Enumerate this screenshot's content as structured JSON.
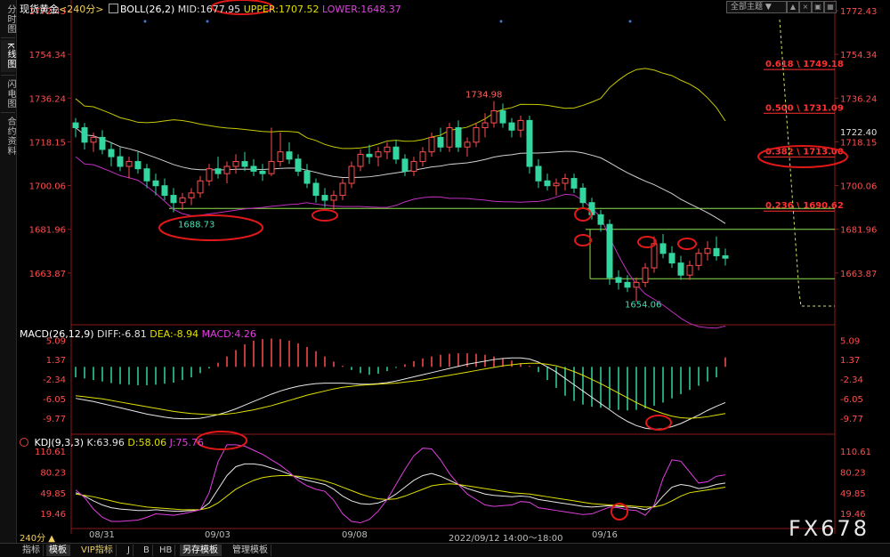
{
  "sidebar": {
    "tabs": [
      {
        "label": "分时图",
        "active": false
      },
      {
        "label": "K线图",
        "active": true
      },
      {
        "label": "闪电图",
        "active": false
      },
      {
        "label": "合约资料",
        "active": false
      }
    ]
  },
  "header": {
    "symbol": "现货黄金",
    "period": "<240分>",
    "boll_name": "BOLL(26,2)",
    "mid": "MID:1677.95",
    "upper": "UPPER:1707.52",
    "lower": "LOWER:1648.37",
    "theme_button": "全部主题",
    "theme_arrow": "▼"
  },
  "window_buttons": [
    "▲",
    "×",
    "▣",
    "▦"
  ],
  "macd_header": {
    "name": "MACD(26,12,9)",
    "diff": "DIFF:-6.81",
    "dea": "DEA:-8.94",
    "macd": "MACD:4.26"
  },
  "kdj_header": {
    "name": "KDJ(9,3,3)",
    "k": "K:63.96",
    "d": "D:58.06",
    "j": "J:75.76"
  },
  "bottom_tabs": [
    {
      "label": "指标",
      "active": false
    },
    {
      "label": "模板",
      "active": true
    },
    {
      "label": "VIP指标",
      "active": false
    },
    {
      "label": "J",
      "active": false
    },
    {
      "label": "B",
      "active": false
    },
    {
      "label": "HB",
      "active": false
    },
    {
      "label": "另存模板",
      "active": true
    },
    {
      "label": "管理模板",
      "active": false
    }
  ],
  "period_badge": "240分 ▲",
  "date_labels": [
    "08/31",
    "09/03",
    "09/08",
    "2022/09/12 14:00～18:00",
    "09/16"
  ],
  "watermark": "FX678",
  "colors": {
    "up": "#ff4d4d",
    "down": "#33d6a0",
    "upper_band": "#c8c800",
    "mid_band": "#d0d0d0",
    "lower_band": "#c030c0",
    "fib": "#ff3030",
    "support": "#90e050"
  },
  "chart_data": {
    "type": "candlestick",
    "price_ticks": [
      "1772.43",
      "1754.34",
      "1736.24",
      "1718.15",
      "1700.06",
      "1681.96",
      "1663.87"
    ],
    "price_range": [
      1645.77,
      1772.43
    ],
    "price_marker": "1722.40",
    "annotations": {
      "high": "1734.98",
      "low_early": "1688.73",
      "low_late": "1654.06"
    },
    "fib_levels": [
      {
        "ratio": "0.618",
        "price": "1749.18"
      },
      {
        "ratio": "0.500",
        "price": "1731.09"
      },
      {
        "ratio": "0.382",
        "price": "1713.00"
      },
      {
        "ratio": "0.236",
        "price": "1690.62"
      }
    ],
    "support_levels": [
      1690.62,
      1681.96,
      1661.5
    ],
    "candles": [
      [
        1726,
        1728,
        1720,
        1724
      ],
      [
        1724,
        1726,
        1715,
        1718
      ],
      [
        1718,
        1722,
        1714,
        1720
      ],
      [
        1720,
        1723,
        1713,
        1715
      ],
      [
        1715,
        1718,
        1708,
        1712
      ],
      [
        1712,
        1716,
        1706,
        1708
      ],
      [
        1708,
        1712,
        1703,
        1710
      ],
      [
        1710,
        1714,
        1705,
        1707
      ],
      [
        1707,
        1709,
        1699,
        1702
      ],
      [
        1702,
        1705,
        1696,
        1700
      ],
      [
        1700,
        1703,
        1694,
        1696
      ],
      [
        1696,
        1699,
        1689,
        1693
      ],
      [
        1693,
        1697,
        1690,
        1695
      ],
      [
        1695,
        1699,
        1692,
        1697
      ],
      [
        1697,
        1704,
        1695,
        1702
      ],
      [
        1702,
        1709,
        1700,
        1707
      ],
      [
        1707,
        1712,
        1703,
        1705
      ],
      [
        1705,
        1710,
        1701,
        1708
      ],
      [
        1708,
        1713,
        1705,
        1710
      ],
      [
        1710,
        1714,
        1706,
        1708
      ],
      [
        1708,
        1711,
        1704,
        1706
      ],
      [
        1706,
        1709,
        1702,
        1705
      ],
      [
        1705,
        1724,
        1704,
        1710
      ],
      [
        1710,
        1722,
        1708,
        1714
      ],
      [
        1714,
        1718,
        1709,
        1711
      ],
      [
        1711,
        1713,
        1704,
        1706
      ],
      [
        1706,
        1709,
        1699,
        1701
      ],
      [
        1701,
        1703,
        1693,
        1696
      ],
      [
        1696,
        1699,
        1691,
        1694
      ],
      [
        1694,
        1698,
        1690,
        1696
      ],
      [
        1696,
        1703,
        1694,
        1701
      ],
      [
        1701,
        1710,
        1699,
        1708
      ],
      [
        1708,
        1715,
        1706,
        1713
      ],
      [
        1713,
        1717,
        1709,
        1712
      ],
      [
        1712,
        1716,
        1708,
        1714
      ],
      [
        1714,
        1718,
        1711,
        1716
      ],
      [
        1716,
        1719,
        1709,
        1711
      ],
      [
        1711,
        1713,
        1704,
        1706
      ],
      [
        1706,
        1712,
        1704,
        1710
      ],
      [
        1710,
        1716,
        1708,
        1714
      ],
      [
        1714,
        1722,
        1712,
        1720
      ],
      [
        1720,
        1724,
        1714,
        1716
      ],
      [
        1716,
        1726,
        1714,
        1724
      ],
      [
        1724,
        1727,
        1714,
        1716
      ],
      [
        1716,
        1720,
        1712,
        1718
      ],
      [
        1718,
        1726,
        1716,
        1724
      ],
      [
        1724,
        1730,
        1720,
        1726
      ],
      [
        1726,
        1735,
        1724,
        1731
      ],
      [
        1731,
        1734,
        1724,
        1726
      ],
      [
        1726,
        1728,
        1720,
        1723
      ],
      [
        1723,
        1729,
        1720,
        1727
      ],
      [
        1727,
        1729,
        1705,
        1708
      ],
      [
        1708,
        1711,
        1699,
        1702
      ],
      [
        1702,
        1705,
        1698,
        1700
      ],
      [
        1700,
        1703,
        1696,
        1701
      ],
      [
        1701,
        1705,
        1698,
        1703
      ],
      [
        1703,
        1705,
        1697,
        1699
      ],
      [
        1699,
        1701,
        1691,
        1693
      ],
      [
        1693,
        1695,
        1686,
        1688
      ],
      [
        1688,
        1690,
        1681,
        1684
      ],
      [
        1684,
        1686,
        1659,
        1662
      ],
      [
        1662,
        1665,
        1657,
        1660
      ],
      [
        1660,
        1663,
        1656,
        1658
      ],
      [
        1658,
        1662,
        1652,
        1660
      ],
      [
        1660,
        1668,
        1658,
        1666
      ],
      [
        1666,
        1679,
        1664,
        1676
      ],
      [
        1676,
        1680,
        1670,
        1672
      ],
      [
        1672,
        1675,
        1666,
        1668
      ],
      [
        1668,
        1671,
        1661,
        1663
      ],
      [
        1663,
        1669,
        1661,
        1667
      ],
      [
        1667,
        1674,
        1665,
        1672
      ],
      [
        1672,
        1677,
        1669,
        1674
      ],
      [
        1674,
        1679,
        1669,
        1671
      ],
      [
        1671,
        1674,
        1667,
        1670
      ]
    ],
    "macd_ticks": [
      "5.09",
      "1.37",
      "-2.34",
      "-6.05",
      "-9.77"
    ],
    "macd_range": [
      -12.5,
      6.5
    ],
    "macd_hist": [
      -2,
      -2.2,
      -2.5,
      -2.8,
      -3.1,
      -3.3,
      -3.4,
      -3.5,
      -3.5,
      -3.4,
      -3.2,
      -3,
      -2.5,
      -2,
      -1.2,
      -0.3,
      0.8,
      2,
      3.2,
      4.3,
      5,
      5.3,
      5.4,
      5.3,
      5,
      4.5,
      3.8,
      3,
      2,
      1,
      0.2,
      -0.6,
      -1.2,
      -1.5,
      -1.3,
      -0.8,
      -0.2,
      0.5,
      1.1,
      1.6,
      2,
      2.3,
      2.5,
      2.6,
      2.6,
      2.5,
      2.3,
      2,
      1.6,
      1.2,
      0.7,
      0.2,
      -1,
      -2.5,
      -4,
      -5.5,
      -6.5,
      -7.2,
      -7.6,
      -7.8,
      -8,
      -8.2,
      -8.3,
      -8.2,
      -7.9,
      -7.4,
      -6.8,
      -6,
      -5.2,
      -4.4,
      -3.6,
      -2.8,
      -2,
      1.8
    ],
    "macd_diff": [
      -6,
      -6.3,
      -6.6,
      -7,
      -7.4,
      -7.8,
      -8.2,
      -8.6,
      -9,
      -9.3,
      -9.6,
      -9.8,
      -9.9,
      -9.9,
      -9.8,
      -9.5,
      -9.1,
      -8.6,
      -8,
      -7.3,
      -6.6,
      -5.9,
      -5.2,
      -4.6,
      -4.1,
      -3.7,
      -3.4,
      -3.2,
      -3.1,
      -3.1,
      -3.1,
      -3.2,
      -3.3,
      -3.3,
      -3.2,
      -3,
      -2.7,
      -2.3,
      -1.9,
      -1.5,
      -1.1,
      -0.7,
      -0.3,
      0.1,
      0.5,
      0.8,
      1.1,
      1.4,
      1.6,
      1.7,
      1.7,
      1.5,
      0.9,
      0,
      -1,
      -2.2,
      -3.4,
      -4.6,
      -5.8,
      -7,
      -8.2,
      -9.4,
      -10.4,
      -11.2,
      -11.7,
      -11.9,
      -11.8,
      -11.4,
      -10.8,
      -10,
      -9.2,
      -8.3,
      -7.5,
      -6.8
    ],
    "macd_dea": [
      -5.5,
      -5.7,
      -5.9,
      -6.1,
      -6.4,
      -6.7,
      -7,
      -7.3,
      -7.6,
      -7.9,
      -8.2,
      -8.5,
      -8.7,
      -8.9,
      -9,
      -9.1,
      -9.1,
      -9,
      -8.8,
      -8.5,
      -8.2,
      -7.8,
      -7.4,
      -6.9,
      -6.4,
      -5.9,
      -5.4,
      -5,
      -4.6,
      -4.2,
      -3.9,
      -3.7,
      -3.5,
      -3.4,
      -3.3,
      -3.2,
      -3.1,
      -2.9,
      -2.7,
      -2.5,
      -2.2,
      -1.9,
      -1.6,
      -1.3,
      -1,
      -0.7,
      -0.4,
      -0.1,
      0.2,
      0.4,
      0.6,
      0.7,
      0.7,
      0.5,
      0.2,
      -0.3,
      -0.9,
      -1.6,
      -2.4,
      -3.2,
      -4.1,
      -5,
      -5.9,
      -6.8,
      -7.6,
      -8.3,
      -8.9,
      -9.4,
      -9.7,
      -9.8,
      -9.7,
      -9.5,
      -9.2,
      -8.9
    ],
    "kdj_ticks": [
      "110.61",
      "80.23",
      "49.85",
      "19.46"
    ],
    "kdj_range": [
      -5,
      125
    ],
    "kdj_k": [
      50,
      45,
      38,
      32,
      28,
      26,
      25,
      24,
      24,
      25,
      24,
      23,
      23,
      24,
      25,
      35,
      55,
      75,
      88,
      92,
      92,
      90,
      86,
      82,
      77,
      72,
      68,
      65,
      62,
      55,
      45,
      38,
      34,
      33,
      35,
      40,
      48,
      58,
      68,
      75,
      78,
      74,
      68,
      62,
      56,
      52,
      48,
      46,
      45,
      44,
      45,
      44,
      40,
      38,
      36,
      34,
      32,
      30,
      29,
      30,
      31,
      30,
      29,
      28,
      25,
      30,
      45,
      58,
      62,
      60,
      56,
      58,
      62,
      64
    ],
    "kdj_d": [
      48,
      46,
      44,
      41,
      38,
      35,
      33,
      31,
      29,
      28,
      27,
      26,
      25,
      25,
      25,
      28,
      35,
      45,
      55,
      62,
      68,
      72,
      74,
      75,
      75,
      74,
      72,
      70,
      67,
      63,
      58,
      53,
      48,
      44,
      41,
      40,
      41,
      45,
      50,
      55,
      60,
      62,
      63,
      62,
      60,
      58,
      56,
      54,
      52,
      50,
      49,
      48,
      46,
      44,
      42,
      40,
      38,
      36,
      34,
      33,
      32,
      31,
      31,
      30,
      29,
      29,
      32,
      38,
      45,
      50,
      52,
      54,
      56,
      58
    ],
    "kdj_j": [
      54,
      43,
      26,
      14,
      8,
      8,
      9,
      10,
      14,
      19,
      18,
      17,
      19,
      22,
      25,
      50,
      95,
      120,
      120,
      118,
      112,
      106,
      98,
      90,
      80,
      68,
      60,
      55,
      52,
      39,
      19,
      8,
      6,
      11,
      23,
      40,
      62,
      84,
      104,
      115,
      114,
      98,
      78,
      62,
      48,
      40,
      32,
      30,
      31,
      32,
      37,
      36,
      28,
      26,
      24,
      22,
      20,
      18,
      19,
      24,
      29,
      28,
      25,
      24,
      17,
      32,
      71,
      98,
      96,
      80,
      64,
      66,
      74,
      76
    ]
  }
}
